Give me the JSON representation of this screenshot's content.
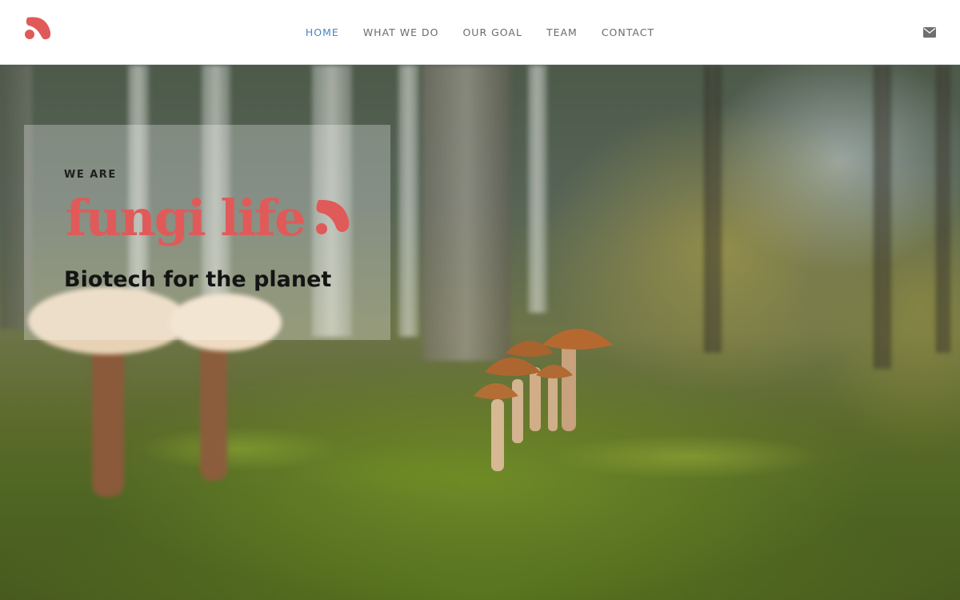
{
  "header": {
    "logo_icon": "fungi-life-logo-icon",
    "nav": [
      {
        "label": "HOME",
        "active": true
      },
      {
        "label": "WHAT WE DO",
        "active": false
      },
      {
        "label": "OUR GOAL",
        "active": false
      },
      {
        "label": "TEAM",
        "active": false
      },
      {
        "label": "CONTACT",
        "active": false
      }
    ],
    "contact_icon": "envelope-icon"
  },
  "hero": {
    "eyebrow": "WE ARE",
    "brand_name": "fungi life",
    "tagline": "Biotech for the planet",
    "background": "forest-floor-mushrooms-photo"
  },
  "colors": {
    "brand": "#e05a5a",
    "nav_text": "#6b6b6b",
    "nav_active": "#4a86c5",
    "navbar_bg": "#ffffff"
  }
}
